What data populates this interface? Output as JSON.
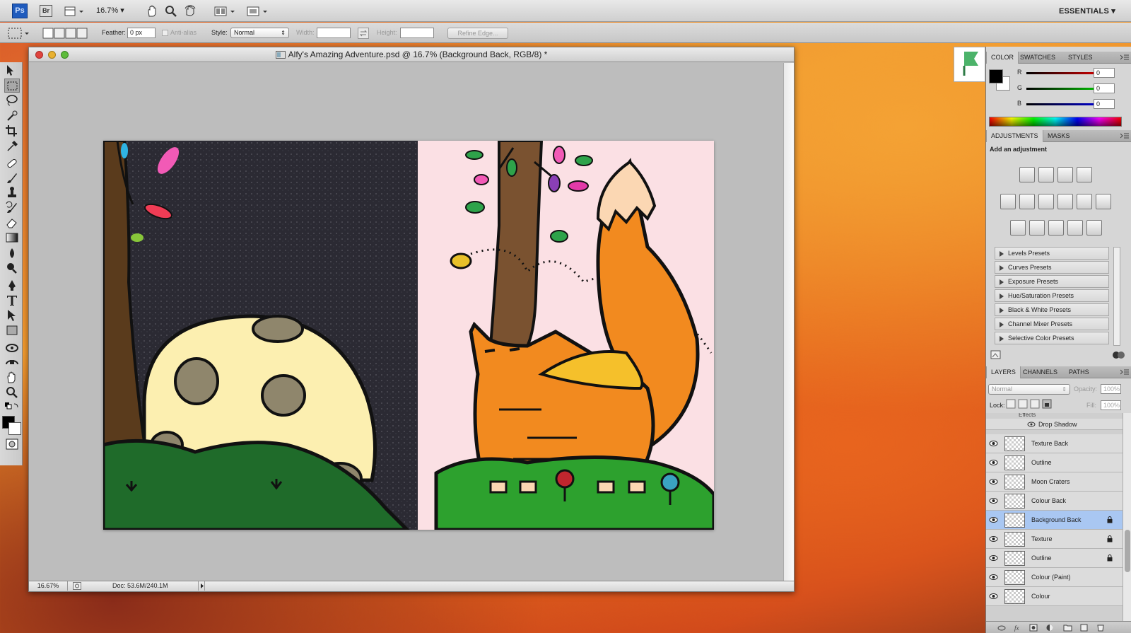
{
  "app": {
    "logo_ps": "Ps",
    "logo_br": "Br",
    "zoom": "16.7%",
    "workspace": "ESSENTIALS"
  },
  "options_bar": {
    "feather_label": "Feather:",
    "feather_value": "0 px",
    "antialias_label": "Anti-alias",
    "style_label": "Style:",
    "style_value": "Normal",
    "width_label": "Width:",
    "height_label": "Height:",
    "refine_edge_label": "Refine Edge..."
  },
  "document": {
    "title": "Alfy's Amazing Adventure.psd @ 16.7% (Background Back, RGB/8) *",
    "zoom": "16.67%",
    "doc_size": "Doc: 53.6M/240.1M"
  },
  "color_panel": {
    "tabs": [
      "COLOR",
      "SWATCHES",
      "STYLES"
    ],
    "channels": [
      {
        "label": "R",
        "value": "0"
      },
      {
        "label": "G",
        "value": "0"
      },
      {
        "label": "B",
        "value": "0"
      }
    ],
    "foreground": "#000000",
    "background": "#ffffff"
  },
  "adjustments_panel": {
    "tabs": [
      "ADJUSTMENTS",
      "MASKS"
    ],
    "heading": "Add an adjustment",
    "presets": [
      "Levels Presets",
      "Curves Presets",
      "Exposure Presets",
      "Hue/Saturation Presets",
      "Black & White Presets",
      "Channel Mixer Presets",
      "Selective Color Presets"
    ]
  },
  "layers_panel": {
    "tabs": [
      "LAYERS",
      "CHANNELS",
      "PATHS"
    ],
    "blend_mode": "Normal",
    "opacity_label": "Opacity:",
    "opacity_value": "100%",
    "lock_label": "Lock:",
    "fill_label": "Fill:",
    "fill_value": "100%",
    "effects_label": "Effects",
    "drop_shadow_label": "Drop Shadow",
    "layers": [
      {
        "name": "Texture Back",
        "locked": false,
        "selected": false
      },
      {
        "name": "Outline",
        "locked": false,
        "selected": false
      },
      {
        "name": "Moon Craters",
        "locked": false,
        "selected": false
      },
      {
        "name": "Colour Back",
        "locked": false,
        "selected": false
      },
      {
        "name": "Background Back",
        "locked": true,
        "selected": true
      },
      {
        "name": "Texture",
        "locked": true,
        "selected": false
      },
      {
        "name": "Outline",
        "locked": true,
        "selected": false
      },
      {
        "name": "Colour (Paint)",
        "locked": false,
        "selected": false
      },
      {
        "name": "Colour",
        "locked": false,
        "selected": false
      }
    ]
  },
  "colors": {
    "accent_blue": "#1f5bbd",
    "selected_layer": "#a9c7f2",
    "fox_orange": "#f28a1f",
    "night_sky": "#2b2a33",
    "moon": "#fcefb0",
    "grass": "#1f6b2a"
  }
}
